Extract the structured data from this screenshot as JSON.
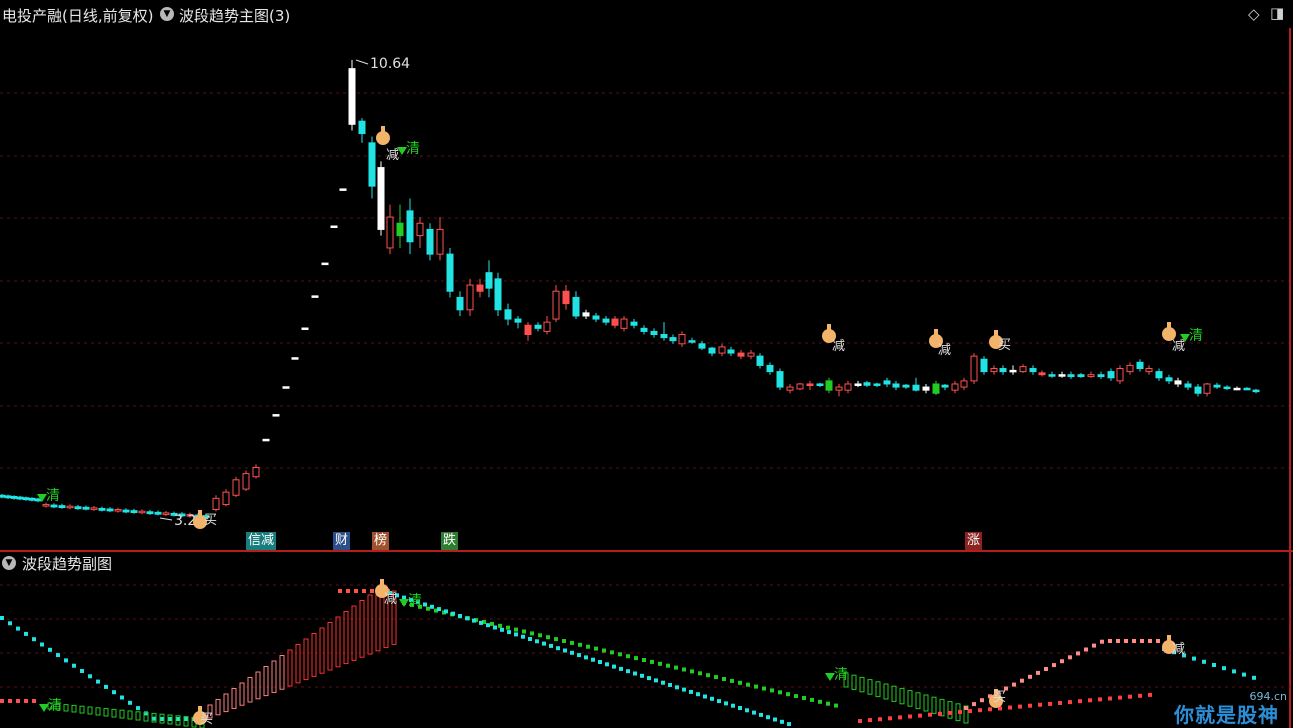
{
  "header": {
    "stock_title": "电投产融(日线,前复权)",
    "indicator_title": "波段趋势主图(3)",
    "collapse_icon": "chevron-down-icon",
    "right_icons": [
      "diamond-icon",
      "window-icon"
    ]
  },
  "sub_header": {
    "title": "波段趋势副图"
  },
  "main_chart": {
    "price_high_label": "10.64",
    "price_low_label": "3.2",
    "signal_labels": {
      "clear": "清",
      "reduce": "减",
      "buy": "买"
    },
    "bottom_tags": [
      {
        "text": "信减",
        "color": "#1a7d7d"
      },
      {
        "text": "财",
        "color": "#2b4f8a"
      },
      {
        "text": "榜",
        "color": "#a0522d"
      },
      {
        "text": "跌",
        "color": "#2e7d32"
      },
      {
        "text": "涨",
        "color": "#8b2323"
      }
    ]
  },
  "colors": {
    "up": "#ff5050",
    "down": "#22e3e3",
    "flat": "#ffffff",
    "signal_green": "#22cc22",
    "grid": "#5a1010",
    "marker": "#ff00ff",
    "panel_border": "#b41e1e"
  },
  "watermark": {
    "site": "694.cn",
    "text": "你就是股神"
  }
}
